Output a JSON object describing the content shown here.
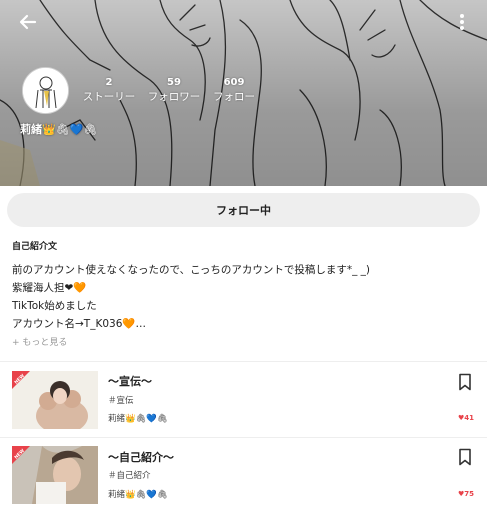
{
  "header": {
    "stats": [
      {
        "count": "2",
        "label": "ストーリー"
      },
      {
        "count": "59",
        "label": "フォロワー"
      },
      {
        "count": "609",
        "label": "フォロー"
      }
    ],
    "username": "莉緒",
    "username_emoji": "👑🖇💙🖇"
  },
  "follow_button": {
    "label": "フォロー中"
  },
  "bio": {
    "heading": "自己紹介文",
    "lines": [
      "前のアカウント使えなくなったので、こっちのアカウントで投稿します*_ _)",
      "紫耀海人担❤🧡",
      "TikTok始めました",
      "アカウント名→T_K036🧡…"
    ],
    "more_label": "+ もっと見る"
  },
  "stories": [
    {
      "badge": "NEW",
      "title": "〜宣伝〜",
      "tag": "＃宣伝",
      "author": "莉緒👑🖇💙🖇",
      "likes": "41"
    },
    {
      "badge": "NEW",
      "title": "〜自己紹介〜",
      "tag": "＃自己紹介",
      "author": "莉緒👑🖇💙🖇",
      "likes": "75"
    }
  ],
  "colors": {
    "accent": "#e8424a",
    "button_bg": "#eeeeee",
    "header_bg": "#d9d9d9"
  }
}
